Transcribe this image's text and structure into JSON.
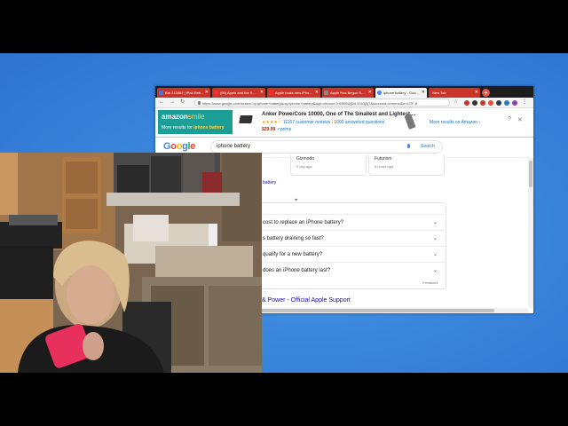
{
  "browser": {
    "tabs": [
      {
        "label": "Bat 213462 | iPad Reti...",
        "icon_color": "#4a76d8"
      },
      {
        "label": "(99) Apple and the S...",
        "icon_color": "#ff2a2a"
      },
      {
        "label": "Apple looks new iPho...",
        "icon_color": "#ff2a2a"
      },
      {
        "label": "Apple Has Begun S...",
        "icon_color": "#888888"
      },
      {
        "label": "iphone battery - Goo...",
        "icon_color": "#4285f4"
      },
      {
        "label": "New Tab",
        "icon_color": ""
      }
    ],
    "address": "https://www.google.com/search?q=iphone+battery&oq=iphone+battery&aqs=chrome.0.69i59l2j0l4.4163j0j7&sourceid=chrome&ie=UTF-8",
    "icons": {
      "back": "back-arrow-icon",
      "forward": "forward-arrow-icon",
      "reload": "reload-icon",
      "star": "star-icon",
      "menu": "kebab-menu-icon"
    }
  },
  "amazon_banner": {
    "logo_main": "amazon",
    "logo_smile": "smile",
    "sub_prefix": "More results for",
    "sub_query": "iphone battery",
    "product_title": "Anker PowerCore 10000, One of The Smallest and Lightest ...",
    "stars": "★★★★☆",
    "reviews": "11167 customer reviews",
    "answered": "1000 answered questions",
    "price": "$29.99",
    "prime": "✓prime",
    "more_results": "More results on Amazon ›",
    "help": "?",
    "close": "✕"
  },
  "google": {
    "logo": "Google",
    "query": "iphone battery",
    "search_button": "Search",
    "cards": [
      {
        "source": "Gizmodo",
        "time": "1 day ago"
      },
      {
        "source": "Futurism",
        "time": "8 hours ago"
      }
    ],
    "link_fragment": "battery",
    "paa": [
      "cost to replace an iPhone battery?",
      "s battery draining so fast?",
      "qualify for a new battery?",
      "does an iPhone battery last?"
    ],
    "feedback": "Feedback",
    "result_link": "& Power - Official Apple Support"
  },
  "colors": {
    "amazon_teal": "#1a9e96",
    "tab_red": "#c9352b",
    "link_blue": "#1a0dab",
    "desktop_blue": "#3a86dd"
  }
}
